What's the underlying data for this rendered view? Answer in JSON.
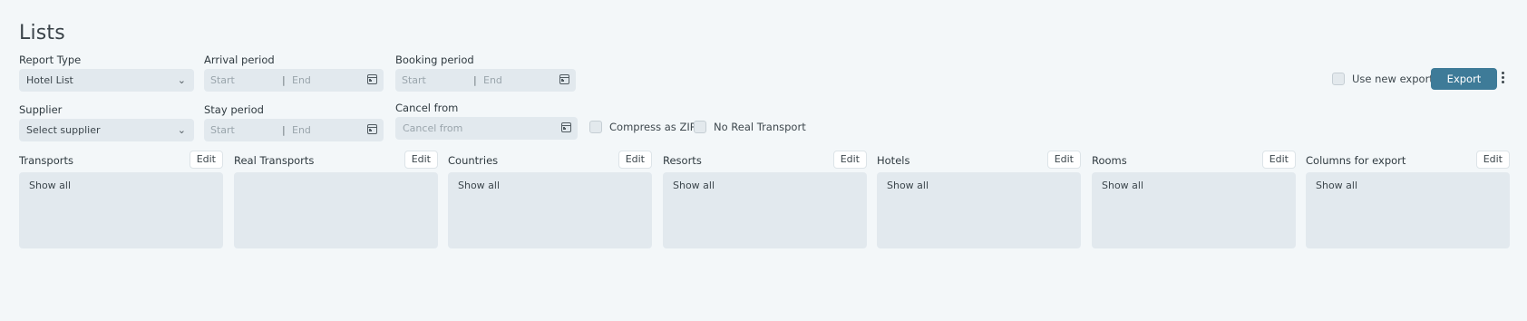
{
  "page": {
    "title": "Lists"
  },
  "filters": {
    "report_type": {
      "label": "Report Type",
      "value": "Hotel List"
    },
    "arrival_period": {
      "label": "Arrival period",
      "start_placeholder": "Start",
      "separator": "|",
      "end_placeholder": "End"
    },
    "booking_period": {
      "label": "Booking period",
      "start_placeholder": "Start",
      "separator": "|",
      "end_placeholder": "End"
    },
    "supplier": {
      "label": "Supplier",
      "value": "Select supplier"
    },
    "stay_period": {
      "label": "Stay period",
      "start_placeholder": "Start",
      "separator": "|",
      "end_placeholder": "End"
    },
    "cancel_from": {
      "label": "Cancel from",
      "placeholder": "Cancel from"
    },
    "compress_zip": {
      "label": "Compress as ZIP",
      "checked": false
    },
    "no_real_transport": {
      "label": "No Real Transport",
      "checked": false
    }
  },
  "export": {
    "use_new_export": {
      "label": "Use new export",
      "checked": false
    },
    "button_label": "Export"
  },
  "lists": [
    {
      "label": "Transports",
      "edit_label": "Edit",
      "content": "Show all"
    },
    {
      "label": "Real Transports",
      "edit_label": "Edit",
      "content": ""
    },
    {
      "label": "Countries",
      "edit_label": "Edit",
      "content": "Show all"
    },
    {
      "label": "Resorts",
      "edit_label": "Edit",
      "content": "Show all"
    },
    {
      "label": "Hotels",
      "edit_label": "Edit",
      "content": "Show all"
    },
    {
      "label": "Rooms",
      "edit_label": "Edit",
      "content": "Show all"
    },
    {
      "label": "Columns for export",
      "edit_label": "Edit",
      "content": "Show all"
    }
  ],
  "colors": {
    "accent": "#3e7b98",
    "background": "#f3f7f9",
    "control_bg": "#e2e9ee"
  },
  "icons": {
    "dropdown": "chevron-down-icon",
    "date": "calendar-icon",
    "menu": "more-vertical-icon"
  }
}
